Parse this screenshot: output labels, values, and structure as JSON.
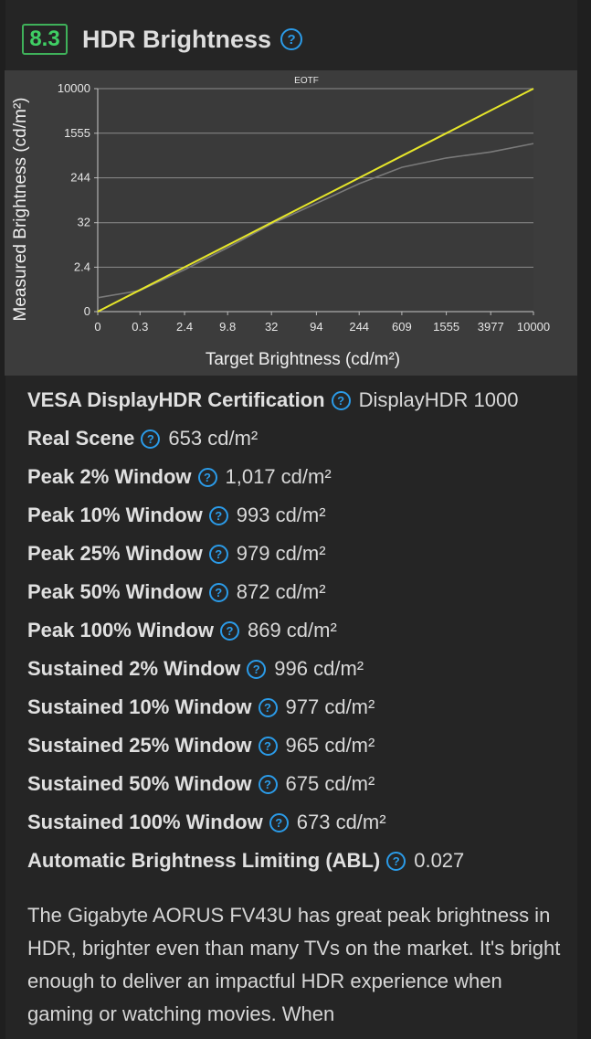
{
  "header": {
    "score": "8.3",
    "title": "HDR Brightness"
  },
  "colors": {
    "score_green": "#3fcf64",
    "help_blue": "#2b9be8",
    "target_line": "#e6e62a",
    "measured_line": "#7a7a7a"
  },
  "icons": {
    "help": "question-circle-icon"
  },
  "chart_data": {
    "type": "line",
    "title": "EOTF",
    "xlabel": "Target Brightness (cd/m²)",
    "ylabel": "Measured Brightness (cd/m²)",
    "x_scale": "pq",
    "y_scale": "pq",
    "xlim": [
      0,
      10000
    ],
    "ylim": [
      0,
      10000
    ],
    "x_ticks": [
      "0",
      "0.3",
      "2.4",
      "9.8",
      "32",
      "94",
      "244",
      "609",
      "1555",
      "3977",
      "10000"
    ],
    "y_ticks": [
      "0",
      "2.4",
      "32",
      "244",
      "1555",
      "10000"
    ],
    "grid": "horizontal",
    "legend": "none",
    "x": [
      0,
      0.3,
      2.4,
      9.8,
      32,
      94,
      244,
      609,
      1555,
      3977,
      10000
    ],
    "series": [
      {
        "values": [
          0,
          0.3,
          2.4,
          9.8,
          32,
          94,
          244,
          609,
          1555,
          3977,
          10000
        ]
      },
      {
        "values": [
          0.1,
          0.28,
          2.0,
          8.5,
          30,
          80,
          190,
          380,
          560,
          720,
          1017
        ]
      }
    ]
  },
  "specs": [
    {
      "label": "VESA DisplayHDR Certification",
      "value": "DisplayHDR 1000"
    },
    {
      "label": "Real Scene",
      "value": "653 cd/m²"
    },
    {
      "label": "Peak 2% Window",
      "value": "1,017 cd/m²"
    },
    {
      "label": "Peak 10% Window",
      "value": "993 cd/m²"
    },
    {
      "label": "Peak 25% Window",
      "value": "979 cd/m²"
    },
    {
      "label": "Peak 50% Window",
      "value": "872 cd/m²"
    },
    {
      "label": "Peak 100% Window",
      "value": "869 cd/m²"
    },
    {
      "label": "Sustained 2% Window",
      "value": "996 cd/m²"
    },
    {
      "label": "Sustained 10% Window",
      "value": "977 cd/m²"
    },
    {
      "label": "Sustained 25% Window",
      "value": "965 cd/m²"
    },
    {
      "label": "Sustained 50% Window",
      "value": "675 cd/m²"
    },
    {
      "label": "Sustained 100% Window",
      "value": "673 cd/m²"
    },
    {
      "label": "Automatic Brightness Limiting (ABL)",
      "value": "0.027"
    }
  ],
  "description": "The Gigabyte AORUS FV43U has great peak brightness in HDR, brighter even than many TVs on the market. It's bright enough to deliver an impactful HDR experience when gaming or watching movies. When"
}
